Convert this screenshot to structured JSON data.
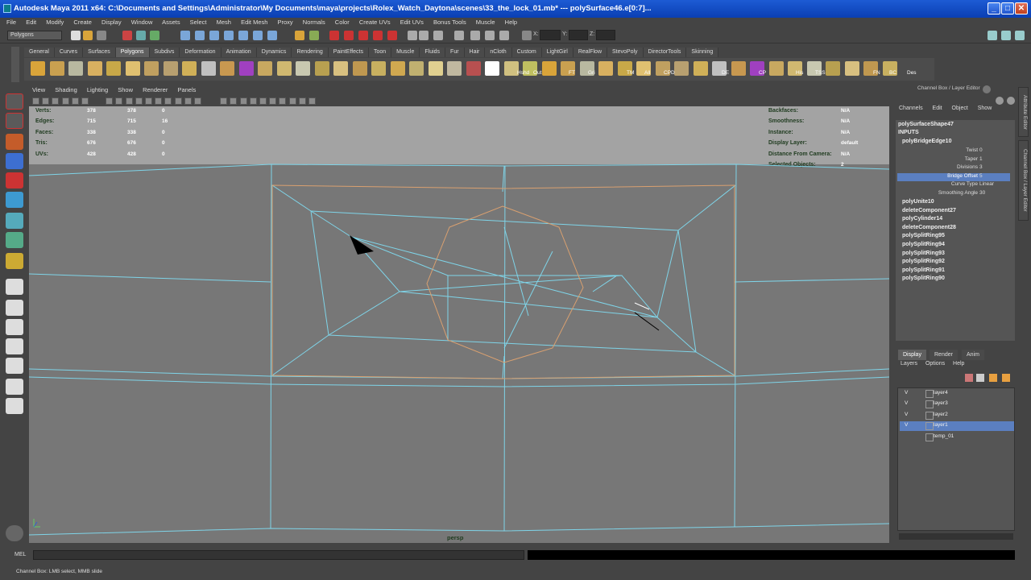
{
  "window": {
    "title": "Autodesk Maya 2011 x64: C:\\Documents and Settings\\Administrator\\My Documents\\maya\\projects\\Rolex_Watch_Daytona\\scenes\\33_the_lock_01.mb*  ---  polySurface46.e[0:7]...",
    "minimize": "_",
    "maximize": "□",
    "close": "✕"
  },
  "menubar": [
    "File",
    "Edit",
    "Modify",
    "Create",
    "Display",
    "Window",
    "Assets",
    "Select",
    "Mesh",
    "Edit Mesh",
    "Proxy",
    "Normals",
    "Color",
    "Create UVs",
    "Edit UVs",
    "Bonus Tools",
    "Muscle",
    "Help"
  ],
  "statusline": {
    "mode": "Polygons",
    "x_label": "X:",
    "y_label": "Y:",
    "z_label": "Z:"
  },
  "shelf_tabs": [
    "General",
    "Curves",
    "Surfaces",
    "Polygons",
    "Subdivs",
    "Deformation",
    "Animation",
    "Dynamics",
    "Rendering",
    "PaintEffects",
    "Toon",
    "Muscle",
    "Fluids",
    "Fur",
    "Hair",
    "nCloth",
    "Custom",
    "LightGirl",
    "RealFlow",
    "StevoPoly",
    "DirectorTools",
    "Skinning"
  ],
  "shelf_active": "Polygons",
  "shelf_labels": [
    "Hshd",
    "Out",
    "FT",
    "Gri",
    "TM",
    "All",
    "CPD",
    "DE",
    "CP",
    "His",
    "TSS",
    "FN",
    "BC",
    "Des"
  ],
  "panel_menu": [
    "View",
    "Shading",
    "Lighting",
    "Show",
    "Renderer",
    "Panels"
  ],
  "hud_left": [
    {
      "label": "Verts:",
      "a": "378",
      "b": "378",
      "c": "0"
    },
    {
      "label": "Edges:",
      "a": "715",
      "b": "715",
      "c": "16"
    },
    {
      "label": "Faces:",
      "a": "338",
      "b": "338",
      "c": "0"
    },
    {
      "label": "Tris:",
      "a": "676",
      "b": "676",
      "c": "0"
    },
    {
      "label": "UVs:",
      "a": "428",
      "b": "428",
      "c": "0"
    }
  ],
  "hud_right": [
    {
      "label": "Backfaces:",
      "value": "N/A"
    },
    {
      "label": "Smoothness:",
      "value": "N/A"
    },
    {
      "label": "Instance:",
      "value": "N/A"
    },
    {
      "label": "Display Layer:",
      "value": "default"
    },
    {
      "label": "Distance From Camera:",
      "value": "N/A"
    },
    {
      "label": "Selected Objects:",
      "value": "2"
    }
  ],
  "camera_label": "persp",
  "channel_box": {
    "header": "Channel Box / Layer Editor",
    "menu": [
      "Channels",
      "Edit",
      "Object",
      "Show"
    ],
    "object_name": "polySurfaceShape47",
    "inputs_label": "INPUTS",
    "active_node": "polyBridgeEdge10",
    "attributes": [
      {
        "name": "Twist",
        "value": "0"
      },
      {
        "name": "Taper",
        "value": "1"
      },
      {
        "name": "Divisions",
        "value": "3"
      },
      {
        "name": "Bridge Offset",
        "value": "5"
      },
      {
        "name": "Curve Type",
        "value": "Linear"
      },
      {
        "name": "Smoothing Angle",
        "value": "30"
      }
    ],
    "history": [
      "polyUnite10",
      "deleteComponent27",
      "polyCylinder14",
      "deleteComponent28",
      "polySplitRing95",
      "polySplitRing94",
      "polySplitRing93",
      "polySplitRing92",
      "polySplitRing91",
      "polySplitRing90"
    ]
  },
  "layer_editor": {
    "tabs": [
      "Display",
      "Render",
      "Anim"
    ],
    "menu": [
      "Layers",
      "Options",
      "Help"
    ],
    "layers": [
      {
        "vis": "V",
        "name": "layer4"
      },
      {
        "vis": "V",
        "name": "layer3"
      },
      {
        "vis": "V",
        "name": "layer2"
      },
      {
        "vis": "V",
        "name": "layer1"
      },
      {
        "vis": "",
        "name": "temp_01"
      }
    ],
    "selected_layer": "layer1"
  },
  "side_tabs": [
    "Attribute Editor",
    "Channel Box / Layer Editor"
  ],
  "command_line": {
    "label": "MEL"
  },
  "help_line": "Channel Box: LMB select, MMB slide",
  "colors": {
    "wire_blue": "#7fd4e8",
    "wire_orange": "#d9a070",
    "selection_blue": "#5b7fc0",
    "hud_text": "#1f3b1f"
  }
}
